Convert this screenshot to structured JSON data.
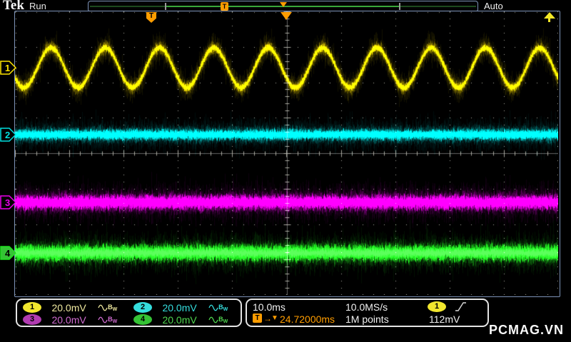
{
  "header": {
    "brand": "Tek",
    "status": "Run",
    "trigger_mode": "Auto"
  },
  "channels": [
    {
      "id": "1",
      "scale": "20.0mV",
      "badge_color": "#f2e72e",
      "text_color": "#f0eaa0",
      "trace_color": "#ffe600"
    },
    {
      "id": "2",
      "scale": "20.0mV",
      "badge_color": "#35dede",
      "text_color": "#35dede",
      "trace_color": "#00e0e0"
    },
    {
      "id": "3",
      "scale": "20.0mV",
      "badge_color": "#b13cb1",
      "text_color": "#d06cd0",
      "trace_color": "#ee00ee"
    },
    {
      "id": "4",
      "scale": "20.0mV",
      "badge_color": "#35c335",
      "text_color": "#4fd44f",
      "trace_color": "#1ee11e"
    }
  ],
  "horizontal": {
    "scale": "10.0ms",
    "sample_rate": "10.0MS/s",
    "record_length": "1M points"
  },
  "trigger": {
    "symbol": "T",
    "source": "1",
    "arrow": "→",
    "marker": "▼",
    "delay": "24.72000ms",
    "level": "112mV",
    "slope": "rising"
  },
  "watermark": "PCMAG.VN",
  "chart_data": {
    "type": "line",
    "title": "Tektronix oscilloscope capture - 4 analog channels",
    "x_axis": {
      "time_per_division": "10.0ms",
      "divisions": 10,
      "total_span": "100ms"
    },
    "y_axis": {
      "divisions": 8,
      "volts_per_division_all_channels": "20.0mV"
    },
    "grid": {
      "columns": 10,
      "rows": 8,
      "style": "dotted graticule with solid center crosshair"
    },
    "series": [
      {
        "name": "CH1",
        "color": "#ffe600",
        "waveform": "noisy sine",
        "cycles_visible": 10,
        "period_estimate": "10ms",
        "frequency_estimate": "100Hz",
        "peak_to_peak_estimate": "23mV",
        "vertical_center_div_from_top": 1.6,
        "render": {
          "type": "sine",
          "center": 79,
          "amp": 28,
          "period": 76.1,
          "peakX": 50,
          "layers": [
            [
              17,
              0.07
            ],
            [
              9,
              0.18
            ],
            [
              4.5,
              0.45
            ],
            [
              2,
              0.85
            ]
          ]
        }
      },
      {
        "name": "CH2",
        "color": "#00e0e0",
        "waveform": "flat noise band",
        "vertical_center_div_from_top": 3.5,
        "render": {
          "type": "band",
          "center": 173,
          "amp": 0,
          "period": 1,
          "peakX": 0,
          "layers": [
            [
              19,
              0.06
            ],
            [
              11,
              0.18
            ],
            [
              7,
              0.45
            ],
            [
              3.5,
              0.8
            ]
          ]
        }
      },
      {
        "name": "CH3",
        "color": "#ee00ee",
        "waveform": "flat noise band",
        "vertical_center_div_from_top": 5.4,
        "render": {
          "type": "band",
          "center": 268,
          "amp": 0,
          "period": 1,
          "peakX": 0,
          "layers": [
            [
              23,
              0.06
            ],
            [
              14,
              0.18
            ],
            [
              10,
              0.45
            ],
            [
              5,
              0.8
            ]
          ]
        }
      },
      {
        "name": "CH4",
        "color": "#1ee11e",
        "waveform": "flat noise band",
        "vertical_center_div_from_top": 6.8,
        "render": {
          "type": "band",
          "center": 339,
          "amp": 0,
          "period": 1,
          "peakX": 0,
          "layers": [
            [
              24,
              0.07
            ],
            [
              15,
              0.2
            ],
            [
              11,
              0.48
            ],
            [
              6,
              0.8
            ]
          ]
        }
      }
    ],
    "acquisition": {
      "mode": "Run",
      "trigger_mode": "Auto",
      "sample_rate": "10.0MS/s",
      "record_length": "1M points"
    },
    "trigger": {
      "source": "CH1",
      "slope": "rising",
      "level": "112mV",
      "delay_from_expansion_point": "24.72000ms"
    }
  }
}
